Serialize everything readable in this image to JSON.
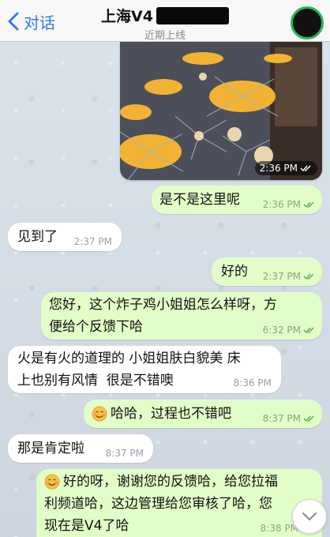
{
  "header": {
    "back_label": "对话",
    "title": "上海V4",
    "subtitle": "近期上线"
  },
  "photo": {
    "time": "2:36 PM"
  },
  "messages": [
    {
      "text": "是不是这里呢",
      "time": "2:36 PM"
    },
    {
      "text": "见到了",
      "time": "2:37 PM"
    },
    {
      "text": "好的",
      "time": "2:37 PM"
    },
    {
      "line1": "您好，这个炸子鸡小姐姐怎么样呀，方",
      "line2": "便给个反馈下哈",
      "time": "6:32 PM"
    },
    {
      "line1": "火是有火的道理的 小姐姐肤白貌美 床",
      "line2": "上也别有风情  很是不错噢",
      "time": "8:36 PM"
    },
    {
      "text": "哈哈，过程也不错吧",
      "time": "8:37 PM"
    },
    {
      "text": "那是肯定啦",
      "time": "8:37 PM"
    },
    {
      "line1": "好的呀，谢谢您的反馈哈，给您拉福",
      "line2": "利频道哈，这边管理给您审核了哈，您",
      "line3": "现在是V4了哈",
      "time": "8:38 PM"
    }
  ],
  "icons": {
    "back": "chevron-left-icon",
    "ticks": "double-check-icon",
    "emoji": "smiling-face-icon",
    "scroll": "chevron-down-icon"
  },
  "colors": {
    "accent": "#2f7ee6",
    "outgoing_bubble": "#e2fec8",
    "incoming_bubble": "#ffffff",
    "online_ring": "#27b45b"
  }
}
